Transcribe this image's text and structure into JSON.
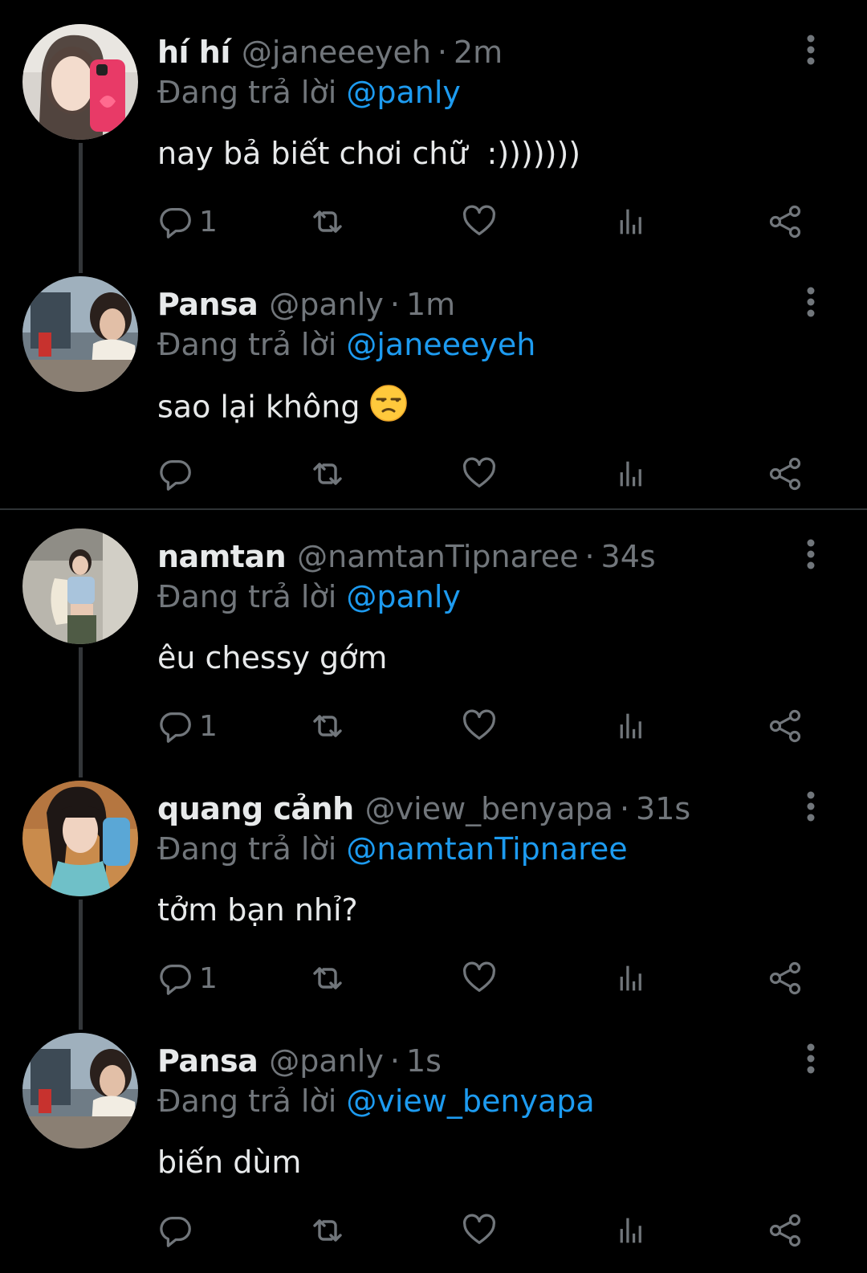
{
  "colors": {
    "background": "#000000",
    "text": "#e7e9ea",
    "muted": "#71767b",
    "mention": "#1d9bf0",
    "thread_line": "#333639"
  },
  "reply_prefix": "Đang trả lời",
  "tweets": [
    {
      "name": "hí hí",
      "handle": "@janeeeyeh",
      "separator": "·",
      "time": "2m",
      "reply_to": "@panly",
      "text": "nay bả biết chơi chữ  :)))))))",
      "reply_count": "1"
    },
    {
      "name": "Pansa",
      "handle": "@panly",
      "separator": "·",
      "time": "1m",
      "reply_to": "@janeeeyeh",
      "text": "sao lại không",
      "emoji": "unamused-face-emoji",
      "reply_count": ""
    },
    {
      "name": "namtan",
      "handle": "@namtanTipnaree",
      "separator": "·",
      "time": "34s",
      "reply_to": "@panly",
      "text": "êu chessy gớm",
      "reply_count": "1"
    },
    {
      "name": "quang cảnh",
      "handle": "@view_benyapa",
      "separator": "·",
      "time": "31s",
      "reply_to": "@namtanTipnaree",
      "text": "tởm bạn nhỉ?",
      "reply_count": "1"
    },
    {
      "name": "Pansa",
      "handle": "@panly",
      "separator": "·",
      "time": "1s",
      "reply_to": "@view_benyapa",
      "text": "biến dùm",
      "reply_count": ""
    }
  ],
  "icons": {
    "reply": "reply-bubble-icon",
    "retweet": "retweet-icon",
    "like": "heart-icon",
    "views": "views-bar-chart-icon",
    "share": "share-icon",
    "more": "more-vertical-icon"
  }
}
